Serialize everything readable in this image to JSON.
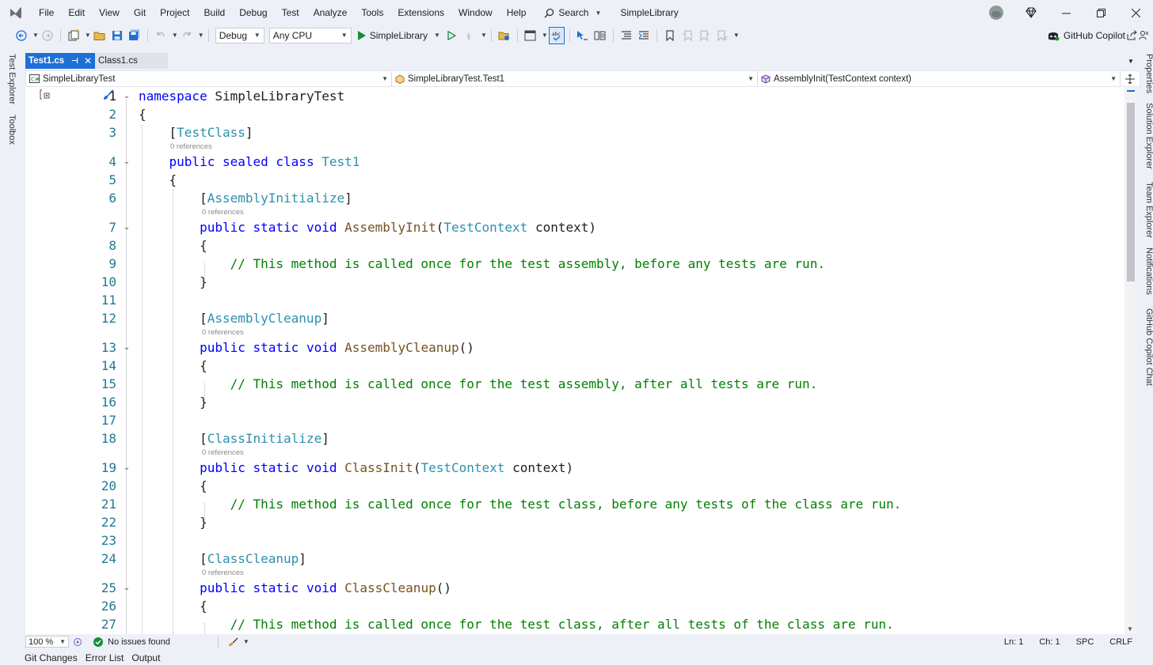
{
  "menu": {
    "items": [
      "File",
      "Edit",
      "View",
      "Git",
      "Project",
      "Build",
      "Debug",
      "Test",
      "Analyze",
      "Tools",
      "Extensions",
      "Window",
      "Help"
    ],
    "search_label": "Search",
    "solution_name": "SimpleLibrary"
  },
  "toolbar": {
    "configuration": "Debug",
    "platform": "Any CPU",
    "run_target": "SimpleLibrary",
    "copilot_label": "GitHub Copilot"
  },
  "left_dock": {
    "tabs": [
      "Test Explorer",
      "Toolbox"
    ]
  },
  "right_dock": {
    "tabs": [
      "Properties",
      "Solution Explorer",
      "Team Explorer",
      "Notifications",
      "GitHub Copilot Chat"
    ]
  },
  "document_tabs": [
    {
      "label": "Test1.cs",
      "active": true
    },
    {
      "label": "Class1.cs",
      "active": false
    }
  ],
  "navigation": {
    "project": "SimpleLibraryTest",
    "type": "SimpleLibraryTest.Test1",
    "member": "AssemblyInit(TestContext context)"
  },
  "editor": {
    "codelens": "0 references",
    "lines": [
      {
        "n": "1"
      },
      {
        "n": "2"
      },
      {
        "n": "3"
      },
      {
        "n": "4"
      },
      {
        "n": "5"
      },
      {
        "n": "6"
      },
      {
        "n": "7"
      },
      {
        "n": "8"
      },
      {
        "n": "9"
      },
      {
        "n": "10"
      },
      {
        "n": "11"
      },
      {
        "n": "12"
      },
      {
        "n": "13"
      },
      {
        "n": "14"
      },
      {
        "n": "15"
      },
      {
        "n": "16"
      },
      {
        "n": "17"
      },
      {
        "n": "18"
      },
      {
        "n": "19"
      },
      {
        "n": "20"
      },
      {
        "n": "21"
      },
      {
        "n": "22"
      },
      {
        "n": "23"
      },
      {
        "n": "24"
      },
      {
        "n": "25"
      },
      {
        "n": "26"
      },
      {
        "n": "27"
      }
    ],
    "tokens": {
      "namespace_kw": "namespace",
      "namespace_name": "SimpleLibraryTest",
      "open_brace": "{",
      "close_brace": "}",
      "attr_testclass": "TestClass",
      "kw_public": "public",
      "kw_sealed": "sealed",
      "kw_class": "class",
      "kw_static": "static",
      "kw_void": "void",
      "class_name": "Test1",
      "attr_assembly_init": "AssemblyInitialize",
      "m_assembly_init": "AssemblyInit",
      "type_testcontext": "TestContext",
      "param_context": "context",
      "comment_assembly_init": "// This method is called once for the test assembly, before any tests are run.",
      "attr_assembly_cleanup": "AssemblyCleanup",
      "m_assembly_cleanup": "AssemblyCleanup",
      "comment_assembly_cleanup": "// This method is called once for the test assembly, after all tests are run.",
      "attr_class_init": "ClassInitialize",
      "m_class_init": "ClassInit",
      "comment_class_init": "// This method is called once for the test class, before any tests of the class are run.",
      "attr_class_cleanup": "ClassCleanup",
      "m_class_cleanup": "ClassCleanup",
      "comment_class_cleanup": "// This method is called once for the test class, after all tests of the class are run."
    }
  },
  "status": {
    "zoom": "100 %",
    "issues": "No issues found",
    "line": "Ln: 1",
    "char": "Ch: 1",
    "whitespace": "SPC",
    "line_ending": "CRLF"
  },
  "bottom_tabs": [
    "Git Changes",
    "Error List",
    "Output"
  ],
  "colors": {
    "accent": "#1e6fd6",
    "keyword": "#0000ff",
    "type": "#2b91af",
    "method": "#74531f",
    "comment": "#008000",
    "line_number": "#237893"
  }
}
